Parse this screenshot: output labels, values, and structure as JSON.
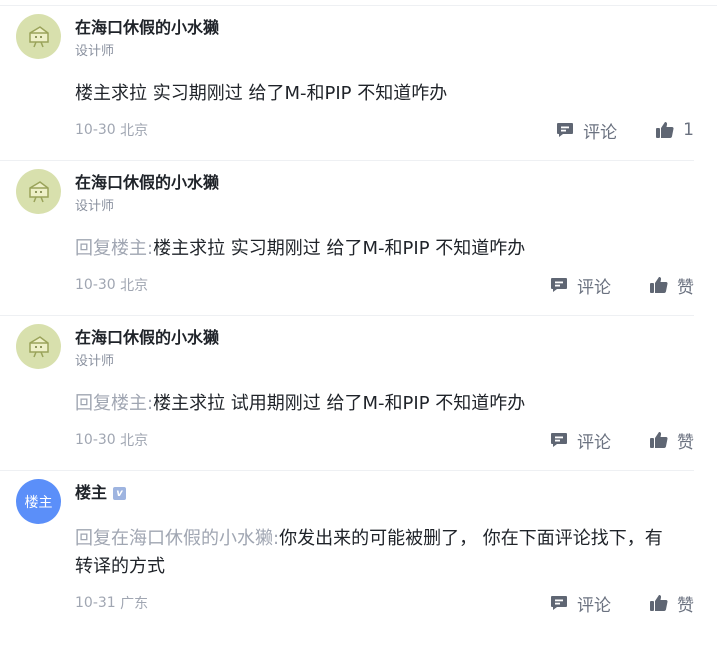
{
  "comments": [
    {
      "author": "在海口休假的小水獭",
      "title": "设计师",
      "reply_prefix": "",
      "content": "楼主求拉 实习期刚过 给了M-和PIP 不知道咋办",
      "date": "10-30",
      "location": "北京",
      "comment_label": "评论",
      "like_label": "1"
    },
    {
      "author": "在海口休假的小水獭",
      "title": "设计师",
      "reply_prefix": "回复楼主:",
      "content": "楼主求拉 实习期刚过 给了M-和PIP 不知道咋办",
      "date": "10-30",
      "location": "北京",
      "comment_label": "评论",
      "like_label": "赞"
    },
    {
      "author": "在海口休假的小水獭",
      "title": "设计师",
      "reply_prefix": "回复楼主:",
      "content": "楼主求拉 试用期刚过 给了M-和PIP 不知道咋办",
      "date": "10-30",
      "location": "北京",
      "comment_label": "评论",
      "like_label": "赞"
    },
    {
      "author": "楼主",
      "avatar_text": "楼主",
      "badge": "v",
      "reply_prefix": "回复在海口休假的小水獭:",
      "content": "你发出来的可能被删了， 你在下面评论找下，有转译的方式",
      "date": "10-31",
      "location": "广东",
      "comment_label": "评论",
      "like_label": "赞"
    }
  ]
}
